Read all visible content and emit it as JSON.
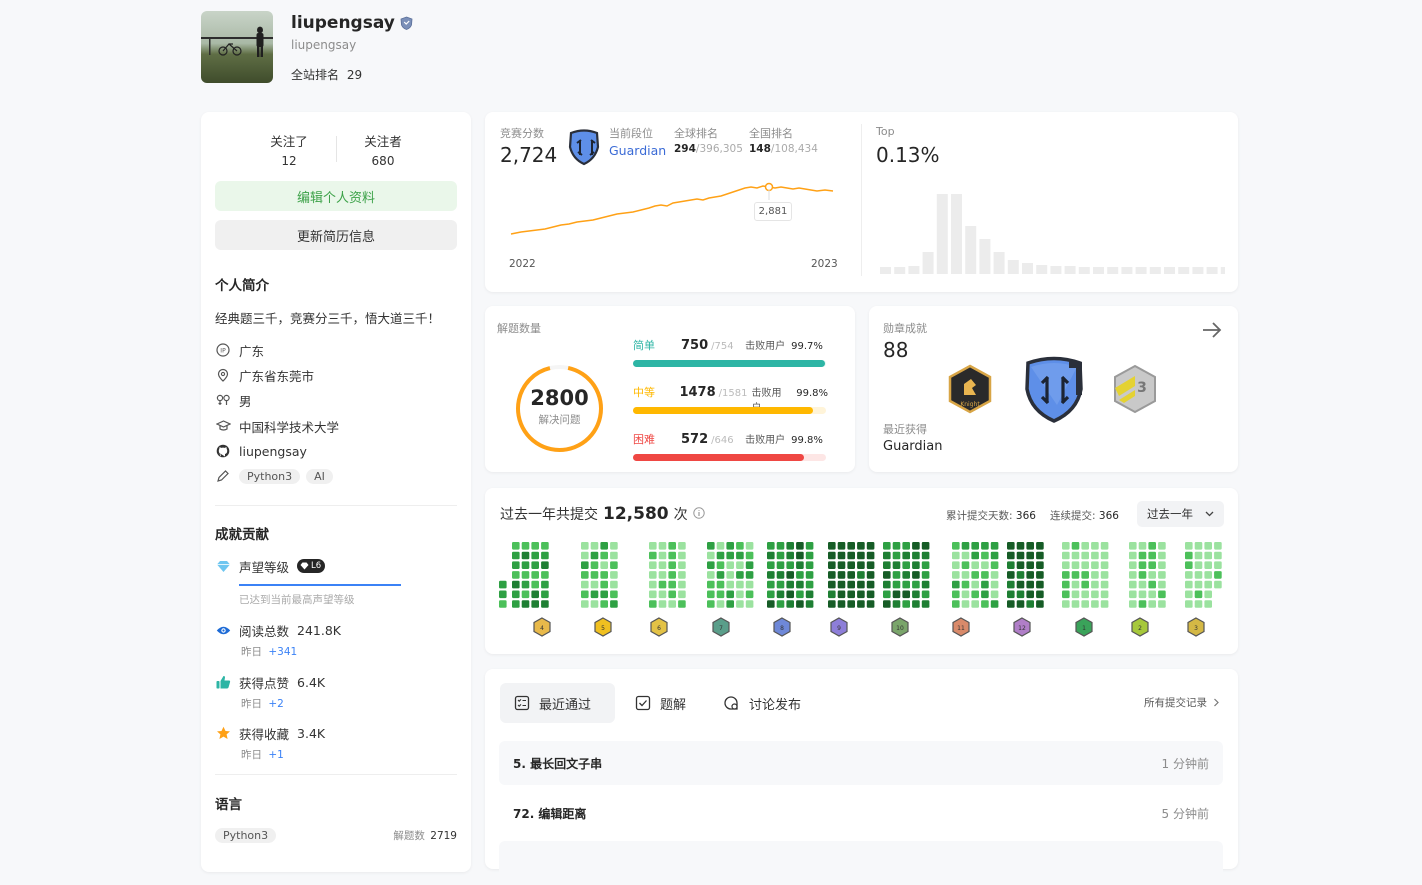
{
  "profile": {
    "display_name": "liupengsay",
    "username": "liupengsay",
    "rank_label": "全站排名",
    "rank_value": "29"
  },
  "follow": {
    "following_label": "关注了",
    "following_value": "12",
    "followers_label": "关注者",
    "followers_value": "680"
  },
  "buttons": {
    "edit_profile": "编辑个人资料",
    "update_resume": "更新简历信息"
  },
  "intro": {
    "title": "个人简介",
    "bio": "经典题三千，竞赛分三千，悟大道三千！",
    "ip": "广东",
    "location": "广东省东莞市",
    "gender": "男",
    "school": "中国科学技术大学",
    "github": "liupengsay",
    "tags": [
      "Python3",
      "AI"
    ]
  },
  "achievements": {
    "title": "成就贡献",
    "reputation_label": "声望等级",
    "reputation_level": "L6",
    "reputation_note": "已达到当前最高声望等级",
    "reads_label": "阅读总数",
    "reads_value": "241.8K",
    "reads_yday": "昨日",
    "reads_delta": "+341",
    "likes_label": "获得点赞",
    "likes_value": "6.4K",
    "likes_yday": "昨日",
    "likes_delta": "+2",
    "favs_label": "获得收藏",
    "favs_value": "3.4K",
    "favs_yday": "昨日",
    "favs_delta": "+1"
  },
  "languages": {
    "title": "语言",
    "items": [
      {
        "name": "Python3",
        "count_label": "解题数",
        "count": "2719"
      }
    ]
  },
  "contest": {
    "score_label": "竞赛分数",
    "score": "2,724",
    "tier_label": "当前段位",
    "tier": "Guardian",
    "global_label": "全球排名",
    "global_rank": "294",
    "global_total": "/396,305",
    "national_label": "全国排名",
    "national_rank": "148",
    "national_total": "/108,434",
    "tooltip": "2,881",
    "x_start": "2022",
    "x_end": "2023",
    "top_label": "Top",
    "top_value": "0.13%"
  },
  "solved": {
    "title": "解题数量",
    "total": "2800",
    "total_label": "解决问题",
    "rows": [
      {
        "name": "简单",
        "count": "750",
        "total": "/754",
        "beat_label": "击败用户",
        "beat": "99.7%",
        "color": "#2db5a5",
        "bg": "#e6f7f3",
        "fraction": 0.995
      },
      {
        "name": "中等",
        "count": "1478",
        "total": "/1581",
        "beat_label": "击败用户",
        "beat": "99.8%",
        "color": "#ffb800",
        "bg": "#fff4d9",
        "fraction": 0.935
      },
      {
        "name": "困难",
        "count": "572",
        "total": "/646",
        "beat_label": "击败用户",
        "beat": "99.8%",
        "color": "#ef4743",
        "bg": "#fde6e5",
        "fraction": 0.885
      }
    ]
  },
  "badges": {
    "title": "勋章成就",
    "count": "88",
    "recent_label": "最近获得",
    "recent": "Guardian",
    "icons": [
      "knight-badge-icon",
      "guardian-badge-icon",
      "annual-badge-icon"
    ]
  },
  "submissions": {
    "prefix": "过去一年共提交",
    "count": "12,580",
    "suffix": "次",
    "total_days_label": "累计提交天数:",
    "total_days": "366",
    "streak_label": "连续提交:",
    "streak": "366",
    "range_select": "过去一年",
    "colors": [
      "#9be29f",
      "#4cc05a",
      "#2ea043",
      "#1e7f33",
      "#165c26"
    ],
    "month_badges": [
      "4",
      "5",
      "6",
      "7",
      "8",
      "9",
      "10",
      "11",
      "12",
      "1",
      "2",
      "3"
    ]
  },
  "tabs": {
    "recent": "最近通过",
    "solutions": "题解",
    "discuss": "讨论发布",
    "all_records": "所有提交记录"
  },
  "recent_list": [
    {
      "title": "5. 最长回文子串",
      "time": "1 分钟前"
    },
    {
      "title": "72. 编辑距离",
      "time": "5 分钟前"
    }
  ]
}
